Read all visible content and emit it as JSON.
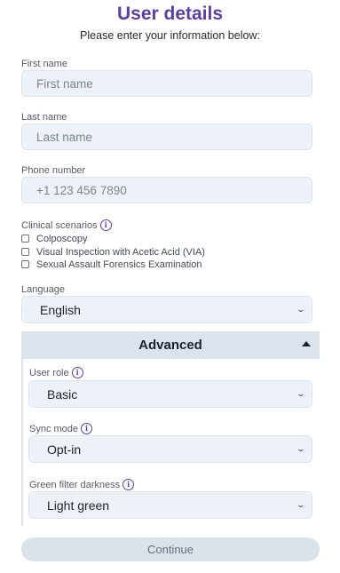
{
  "header": {
    "title": "User details",
    "subtitle": "Please enter your information below:"
  },
  "fields": {
    "first_name": {
      "label": "First name",
      "placeholder": "First name",
      "value": ""
    },
    "last_name": {
      "label": "Last name",
      "placeholder": "Last name",
      "value": ""
    },
    "phone": {
      "label": "Phone number",
      "placeholder": "+1 123 456 7890",
      "value": ""
    }
  },
  "clinical": {
    "label": "Clinical scenarios",
    "info_icon": "info-icon",
    "options": [
      {
        "label": "Colposcopy",
        "checked": false
      },
      {
        "label": "Visual Inspection with Acetic Acid (VIA)",
        "checked": false
      },
      {
        "label": "Sexual Assault Forensics Examination",
        "checked": false
      }
    ]
  },
  "language": {
    "label": "Language",
    "value": "English"
  },
  "advanced": {
    "title": "Advanced",
    "expanded": true,
    "user_role": {
      "label": "User role",
      "value": "Basic"
    },
    "sync_mode": {
      "label": "Sync mode",
      "value": "Opt-in"
    },
    "green_filter": {
      "label": "Green filter darkness",
      "value": "Light green"
    }
  },
  "actions": {
    "continue_label": "Continue",
    "continue_enabled": false
  },
  "colors": {
    "title": "#5a3fa0",
    "field_bg": "#edf2f8",
    "advanced_bg": "#dbe3ec",
    "button_bg": "#dbe2ea"
  }
}
